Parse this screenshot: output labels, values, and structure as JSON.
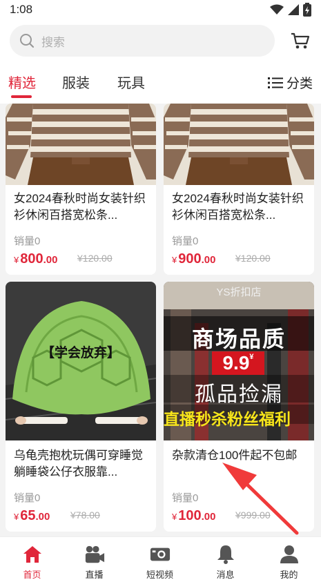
{
  "status": {
    "time": "1:08"
  },
  "search": {
    "placeholder": "搜索"
  },
  "tabs": [
    {
      "label": "精选"
    },
    {
      "label": "服装"
    },
    {
      "label": "玩具"
    }
  ],
  "category_label": "分类",
  "products": [
    {
      "title": "女2024春秋时尚女装针织衫休闲百搭宽松条...",
      "sales": "销量0",
      "price_symbol": "¥",
      "price_int": "800",
      "price_dec": ".00",
      "orig_price": "¥120.00"
    },
    {
      "title": "女2024春秋时尚女装针织衫休闲百搭宽松条...",
      "sales": "销量0",
      "price_symbol": "¥",
      "price_int": "900",
      "price_dec": ".00",
      "orig_price": "¥120.00"
    },
    {
      "title": "乌龟壳抱枕玩偶可穿睡觉躺睡袋公仔衣服靠...",
      "sales": "销量0",
      "price_symbol": "¥",
      "price_int": "65",
      "price_dec": ".00",
      "orig_price": "¥78.00",
      "image_caption": "【学会放弃】"
    },
    {
      "title": "杂款清仓100件起不包邮",
      "sales": "销量0",
      "price_symbol": "¥",
      "price_int": "100",
      "price_dec": ".00",
      "orig_price": "¥999.00",
      "image_shop": "YS折扣店",
      "image_line1": "商场品质",
      "image_price": "9.9",
      "image_price_symbol": "¥",
      "image_line2": "孤品捡漏",
      "image_line3": "直播秒杀粉丝福利"
    }
  ],
  "bottom_nav": [
    {
      "label": "首页",
      "icon": "home-icon"
    },
    {
      "label": "直播",
      "icon": "live-camera-icon"
    },
    {
      "label": "短视频",
      "icon": "video-icon"
    },
    {
      "label": "消息",
      "icon": "bell-icon"
    },
    {
      "label": "我的",
      "icon": "user-icon"
    }
  ],
  "colors": {
    "accent": "#e0263a",
    "price": "#e0263a"
  }
}
